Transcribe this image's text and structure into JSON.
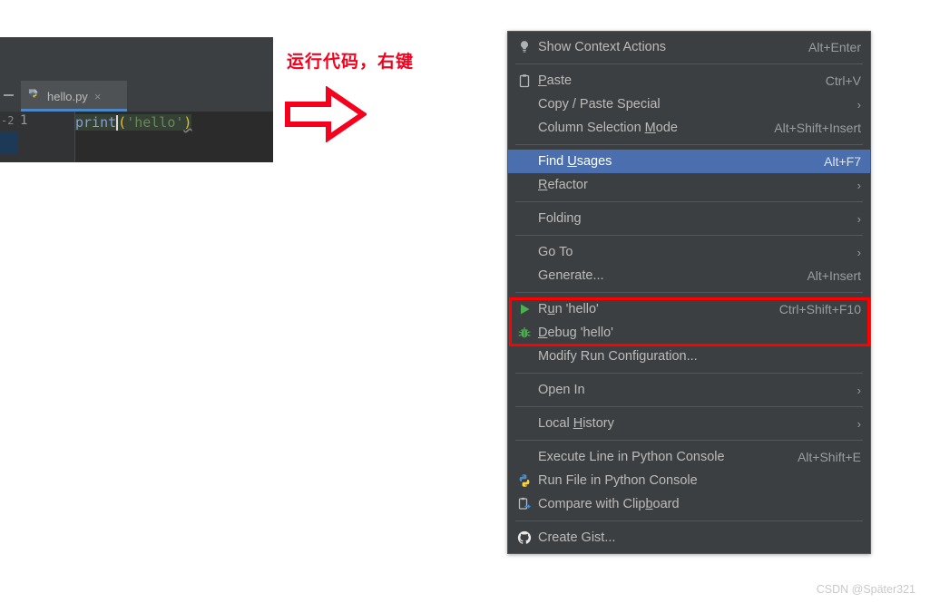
{
  "editor": {
    "tab": {
      "filename": "hello.py",
      "close_glyph": "×",
      "icon": "python-file-icon"
    },
    "gutter": {
      "marker": "-2",
      "line_number": "1"
    },
    "code": {
      "function": "print",
      "open_paren": "(",
      "string": "'hello'",
      "close_paren": ")"
    }
  },
  "annotation": {
    "text": "运行代码，右键",
    "color": "#f5001d",
    "arrow": "right-arrow-outline"
  },
  "context_menu": {
    "highlight_color": "#4b6eaf",
    "background_color": "#3c3f41",
    "emphasis_box_color": "#ff0000",
    "items": [
      {
        "id": "show-context-actions",
        "label": "Show Context Actions",
        "accel": "Alt+Enter",
        "icon": "lightbulb-icon",
        "arrow": false,
        "selected": false,
        "mnemonic": ""
      },
      {
        "separator": true
      },
      {
        "id": "paste",
        "label": "Paste",
        "accel": "Ctrl+V",
        "icon": "clipboard-icon",
        "arrow": false,
        "selected": false,
        "mnemonic": "P"
      },
      {
        "id": "copy-paste-special",
        "label": "Copy / Paste Special",
        "accel": "",
        "icon": "",
        "arrow": true,
        "selected": false,
        "mnemonic": ""
      },
      {
        "id": "column-selection-mode",
        "label": "Column Selection Mode",
        "accel": "Alt+Shift+Insert",
        "icon": "",
        "arrow": false,
        "selected": false,
        "mnemonic": "M"
      },
      {
        "separator": true
      },
      {
        "id": "find-usages",
        "label": "Find Usages",
        "accel": "Alt+F7",
        "icon": "",
        "arrow": false,
        "selected": true,
        "mnemonic": "U"
      },
      {
        "id": "refactor",
        "label": "Refactor",
        "accel": "",
        "icon": "",
        "arrow": true,
        "selected": false,
        "mnemonic": "R"
      },
      {
        "separator": true
      },
      {
        "id": "folding",
        "label": "Folding",
        "accel": "",
        "icon": "",
        "arrow": true,
        "selected": false,
        "mnemonic": ""
      },
      {
        "separator": true
      },
      {
        "id": "go-to",
        "label": "Go To",
        "accel": "",
        "icon": "",
        "arrow": true,
        "selected": false,
        "mnemonic": ""
      },
      {
        "id": "generate",
        "label": "Generate...",
        "accel": "Alt+Insert",
        "icon": "",
        "arrow": false,
        "selected": false,
        "mnemonic": ""
      },
      {
        "separator": true
      },
      {
        "id": "run-hello",
        "label": "Run 'hello'",
        "accel": "Ctrl+Shift+F10",
        "icon": "run-play-icon",
        "arrow": false,
        "selected": false,
        "mnemonic": "u"
      },
      {
        "id": "debug-hello",
        "label": "Debug 'hello'",
        "accel": "",
        "icon": "debug-bug-icon",
        "arrow": false,
        "selected": false,
        "mnemonic": "D"
      },
      {
        "id": "modify-run-configuration",
        "label": "Modify Run Configuration...",
        "accel": "",
        "icon": "",
        "arrow": false,
        "selected": false,
        "mnemonic": ""
      },
      {
        "separator": true
      },
      {
        "id": "open-in",
        "label": "Open In",
        "accel": "",
        "icon": "",
        "arrow": true,
        "selected": false,
        "mnemonic": ""
      },
      {
        "separator": true
      },
      {
        "id": "local-history",
        "label": "Local History",
        "accel": "",
        "icon": "",
        "arrow": true,
        "selected": false,
        "mnemonic": "H"
      },
      {
        "separator": true
      },
      {
        "id": "execute-line-in-python-console",
        "label": "Execute Line in Python Console",
        "accel": "Alt+Shift+E",
        "icon": "",
        "arrow": false,
        "selected": false,
        "mnemonic": ""
      },
      {
        "id": "run-file-in-python-console",
        "label": "Run File in Python Console",
        "accel": "",
        "icon": "python-icon",
        "arrow": false,
        "selected": false,
        "mnemonic": ""
      },
      {
        "id": "compare-with-clipboard",
        "label": "Compare with Clipboard",
        "accel": "",
        "icon": "compare-clipboard-icon",
        "arrow": false,
        "selected": false,
        "mnemonic": "b"
      },
      {
        "separator": true
      },
      {
        "id": "create-gist",
        "label": "Create Gist...",
        "accel": "",
        "icon": "github-icon",
        "arrow": false,
        "selected": false,
        "mnemonic": ""
      }
    ]
  },
  "watermark": {
    "text": "CSDN @Später321"
  }
}
